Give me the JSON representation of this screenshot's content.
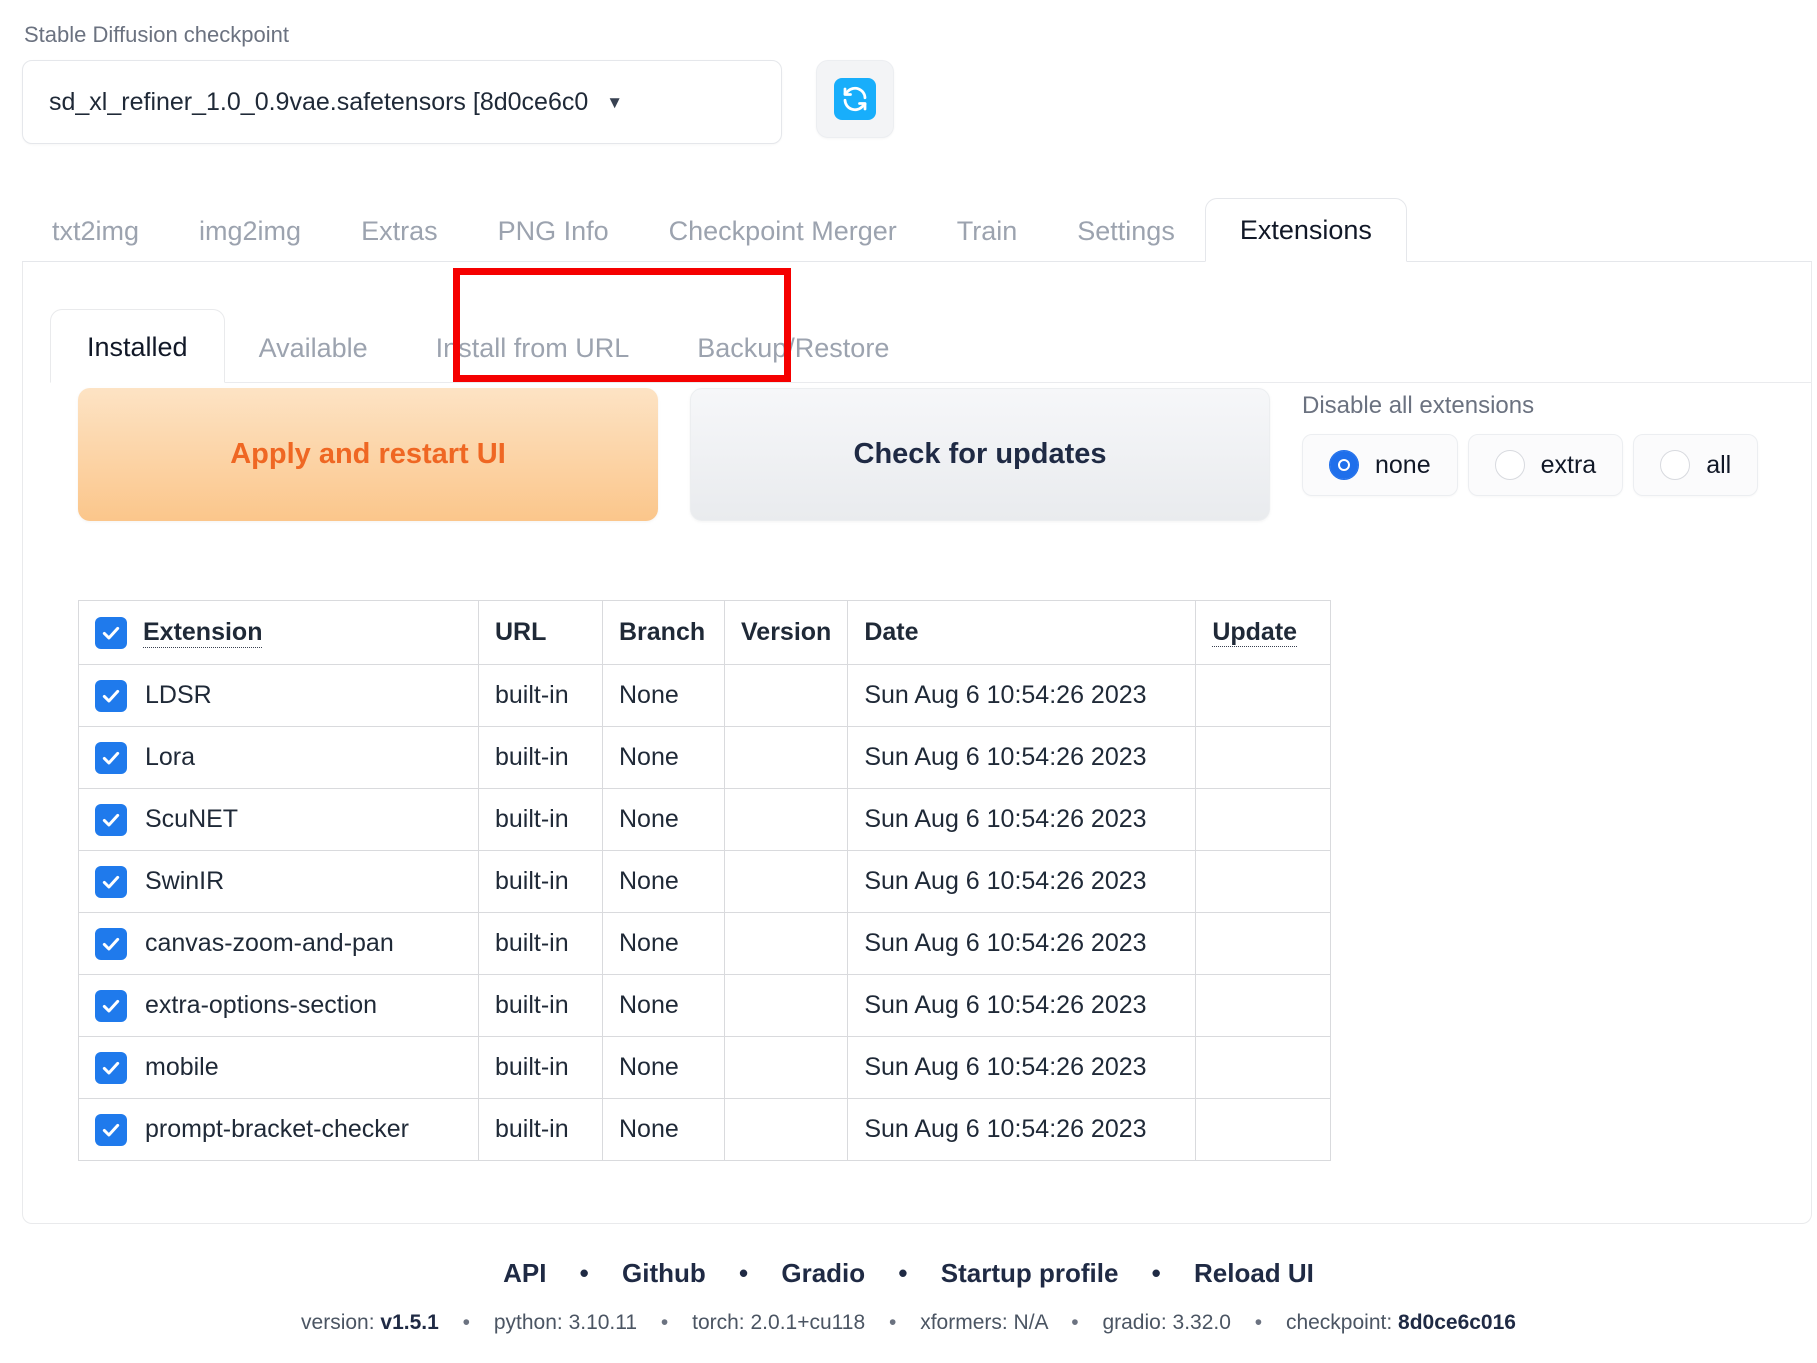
{
  "checkpoint": {
    "label": "Stable Diffusion checkpoint",
    "value": "sd_xl_refiner_1.0_0.9vae.safetensors [8d0ce6c0",
    "caret": "▼",
    "refresh_icon": "refresh-icon"
  },
  "main_tabs": [
    {
      "label": "txt2img",
      "active": false
    },
    {
      "label": "img2img",
      "active": false
    },
    {
      "label": "Extras",
      "active": false
    },
    {
      "label": "PNG Info",
      "active": false
    },
    {
      "label": "Checkpoint Merger",
      "active": false
    },
    {
      "label": "Train",
      "active": false
    },
    {
      "label": "Settings",
      "active": false
    },
    {
      "label": "Extensions",
      "active": true
    }
  ],
  "sub_tabs": [
    {
      "label": "Installed",
      "active": true
    },
    {
      "label": "Available",
      "active": false
    },
    {
      "label": "Install from URL",
      "active": false
    },
    {
      "label": "Backup/Restore",
      "active": false
    }
  ],
  "buttons": {
    "apply": "Apply and restart UI",
    "check": "Check for updates"
  },
  "disable_all": {
    "label": "Disable all extensions",
    "options": [
      {
        "label": "none",
        "selected": true
      },
      {
        "label": "extra",
        "selected": false
      },
      {
        "label": "all",
        "selected": false
      }
    ]
  },
  "table": {
    "headers": {
      "extension": "Extension",
      "url": "URL",
      "branch": "Branch",
      "version": "Version",
      "date": "Date",
      "update": "Update"
    },
    "header_checked": true,
    "rows": [
      {
        "checked": true,
        "extension": "LDSR",
        "url": "built-in",
        "branch": "None",
        "version": "",
        "date": "Sun Aug 6 10:54:26 2023",
        "update": ""
      },
      {
        "checked": true,
        "extension": "Lora",
        "url": "built-in",
        "branch": "None",
        "version": "",
        "date": "Sun Aug 6 10:54:26 2023",
        "update": ""
      },
      {
        "checked": true,
        "extension": "ScuNET",
        "url": "built-in",
        "branch": "None",
        "version": "",
        "date": "Sun Aug 6 10:54:26 2023",
        "update": ""
      },
      {
        "checked": true,
        "extension": "SwinIR",
        "url": "built-in",
        "branch": "None",
        "version": "",
        "date": "Sun Aug 6 10:54:26 2023",
        "update": ""
      },
      {
        "checked": true,
        "extension": "canvas-zoom-and-pan",
        "url": "built-in",
        "branch": "None",
        "version": "",
        "date": "Sun Aug 6 10:54:26 2023",
        "update": ""
      },
      {
        "checked": true,
        "extension": "extra-options-section",
        "url": "built-in",
        "branch": "None",
        "version": "",
        "date": "Sun Aug 6 10:54:26 2023",
        "update": ""
      },
      {
        "checked": true,
        "extension": "mobile",
        "url": "built-in",
        "branch": "None",
        "version": "",
        "date": "Sun Aug 6 10:54:26 2023",
        "update": ""
      },
      {
        "checked": true,
        "extension": "prompt-bracket-checker",
        "url": "built-in",
        "branch": "None",
        "version": "",
        "date": "Sun Aug 6 10:54:26 2023",
        "update": ""
      }
    ]
  },
  "footer": {
    "links": [
      "API",
      "Github",
      "Gradio",
      "Startup profile",
      "Reload UI"
    ],
    "separator": "•",
    "version_items": [
      {
        "key": "version:",
        "value": "v1.5.1",
        "bold": true
      },
      {
        "key": "python:",
        "value": "3.10.11",
        "bold": false
      },
      {
        "key": "torch:",
        "value": "2.0.1+cu118",
        "bold": false
      },
      {
        "key": "xformers:",
        "value": "N/A",
        "bold": false
      },
      {
        "key": "gradio:",
        "value": "3.32.0",
        "bold": false
      },
      {
        "key": "checkpoint:",
        "value": "8d0ce6c016",
        "bold": true
      }
    ]
  },
  "highlight": {
    "color": "#f50000",
    "target": "Install from URL"
  },
  "colors": {
    "accent_blue": "#1f7aec",
    "refresh_blue": "#18aefb",
    "apply_text": "#ef6723",
    "radio_blue": "#1f6feb"
  }
}
